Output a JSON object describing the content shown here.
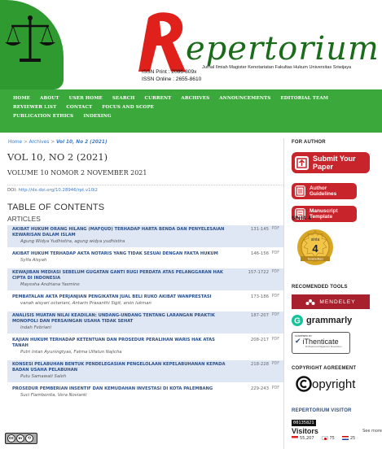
{
  "header": {
    "logo_text": "epertorium",
    "tagline": "Jurnal Ilmiah Magister Kenotariatan Fakultas Hukum Universitas Sriwijaya",
    "issn_print": "ISSN Print   : 2086-809x",
    "issn_online": "ISSN Online : 2655-8610"
  },
  "nav": {
    "items": [
      "HOME",
      "ABOUT",
      "USER HOME",
      "SEARCH",
      "CURRENT",
      "ARCHIVES",
      "ANNOUNCEMENTS",
      "EDITORIAL TEAM",
      "REVIEWER LIST",
      "CONTACT",
      "FOCUS AND SCOPE"
    ],
    "items_row2": [
      "PUBLICATION ETHICS",
      "INDEXING"
    ]
  },
  "breadcrumb": {
    "home": "Home",
    "sep": " > ",
    "archives": "Archives",
    "current": "Vol 10, No 2 (2021)"
  },
  "issue": {
    "title": "VOL 10, NO 2 (2021)",
    "subtitle": "VOLUME 10 NOMOR 2 NOVEMBER 2021",
    "doi_label": "DOI: ",
    "doi_link": "http://dx.doi.org/10.28946/rpt.v10i2",
    "toc_title": "TABLE OF CONTENTS",
    "section": "ARTICLES"
  },
  "articles": [
    {
      "title": "AKIBAT HUKUM ORANG HILANG (MAFQUD) TERHADAP HARTA BENDA DAN PENYELESAIAN KEWARISAN DALAM ISLAM",
      "authors": "Agung Widya Yudhistira, agung widya yudhistira",
      "pages": "131-145",
      "pdf": "PDF"
    },
    {
      "title": "AKIBAT HUKUM TERHADAP AKTA NOTARIS YANG TIDAK SESUAI DENGAN FAKTA HUKUM",
      "authors": "Sylfa Aisyah",
      "pages": "146-156",
      "pdf": "PDF"
    },
    {
      "title": "KEWAJIBAN MEDIASI SEBELUM GUGATAN GANTI RUGI PERDATA ATAS PELANGGARAN HAK CIPTA DI INDONESIA",
      "authors": "Mayesha Andriana Yasmine",
      "pages": "157-1722",
      "pdf": "PDF"
    },
    {
      "title": "PEMBATALAN AKTA PERJANJIAN PENGIKATAN JUAL BELI RUKO AKIBAT WANPRESTASI",
      "authors": "vanah aisyari octariani, Antarin Prasanthi Sigit, arsin lukman",
      "pages": "173-186",
      "pdf": "PDF"
    },
    {
      "title": "ANALISIS MUATAN NILAI KEADILAN: UNDANG-UNDANG TENTANG LARANGAN PRAKTIK MONOPOLI DAN PERSAINGAN USAHA TIDAK SEHAT",
      "authors": "Indah Febriani",
      "pages": "187-207",
      "pdf": "PDF"
    },
    {
      "title": "KAJIAN HUKUM TERHADAP KETENTUAN DAN PROSEDUR PERALIHAN WARIS HAK ATAS TANAH",
      "authors": "Putri Intan Ayuningtyas, Fatma Ulfatun Najicha",
      "pages": "208-217",
      "pdf": "PDF"
    },
    {
      "title": "KONSESI PELABUHAN BENTUK PENDELEGASIAN PENGELOLAAN KEPELABUHANAN KEPADA BADAN USAHA PELABUHAN",
      "authors": "Putu Samawati Saleh",
      "pages": "218-228",
      "pdf": "PDF"
    },
    {
      "title": "PROSEDUR PEMBERIAN INSENTIF DAN KEMUDAHAN INVESTASI DI KOTA PALEMBANG",
      "authors": "Suci Flambonita, Vera Novianti",
      "pages": "229-243",
      "pdf": "PDF"
    }
  ],
  "sidebar": {
    "for_author": "FOR AUTHOR",
    "submit_line1": "Submit Your",
    "submit_line2": "Paper",
    "guidelines_line1": "Author",
    "guidelines_line2": "Guidelines",
    "template_line1": "Manuscript",
    "template_line2": "Template",
    "sinta": "SINTA 4",
    "sinta_badge_top": "sinta",
    "sinta_badge_num": "4",
    "sinta_badge_bottom": "Terakreditasi",
    "tools": "RECOMENDED TOOLS",
    "mendeley": "MENDELEY",
    "grammarly": "grammarly",
    "ithenticate_small": "SCREENED BY",
    "ithenticate": "iThenticate",
    "ithenticate_sub": "Professional Plagiarism Prevention",
    "copyright_h": "COPYRIGHT AGREEMENT",
    "copyright": "opyright",
    "visitor_h": "REPERTORIUM VISITOR",
    "visitor_count": "00135821",
    "visitors": "Visitors",
    "see_more": "See more",
    "flag_counts": [
      "55,207",
      "75",
      "25"
    ]
  },
  "footer": {
    "cc_by": "BY"
  }
}
